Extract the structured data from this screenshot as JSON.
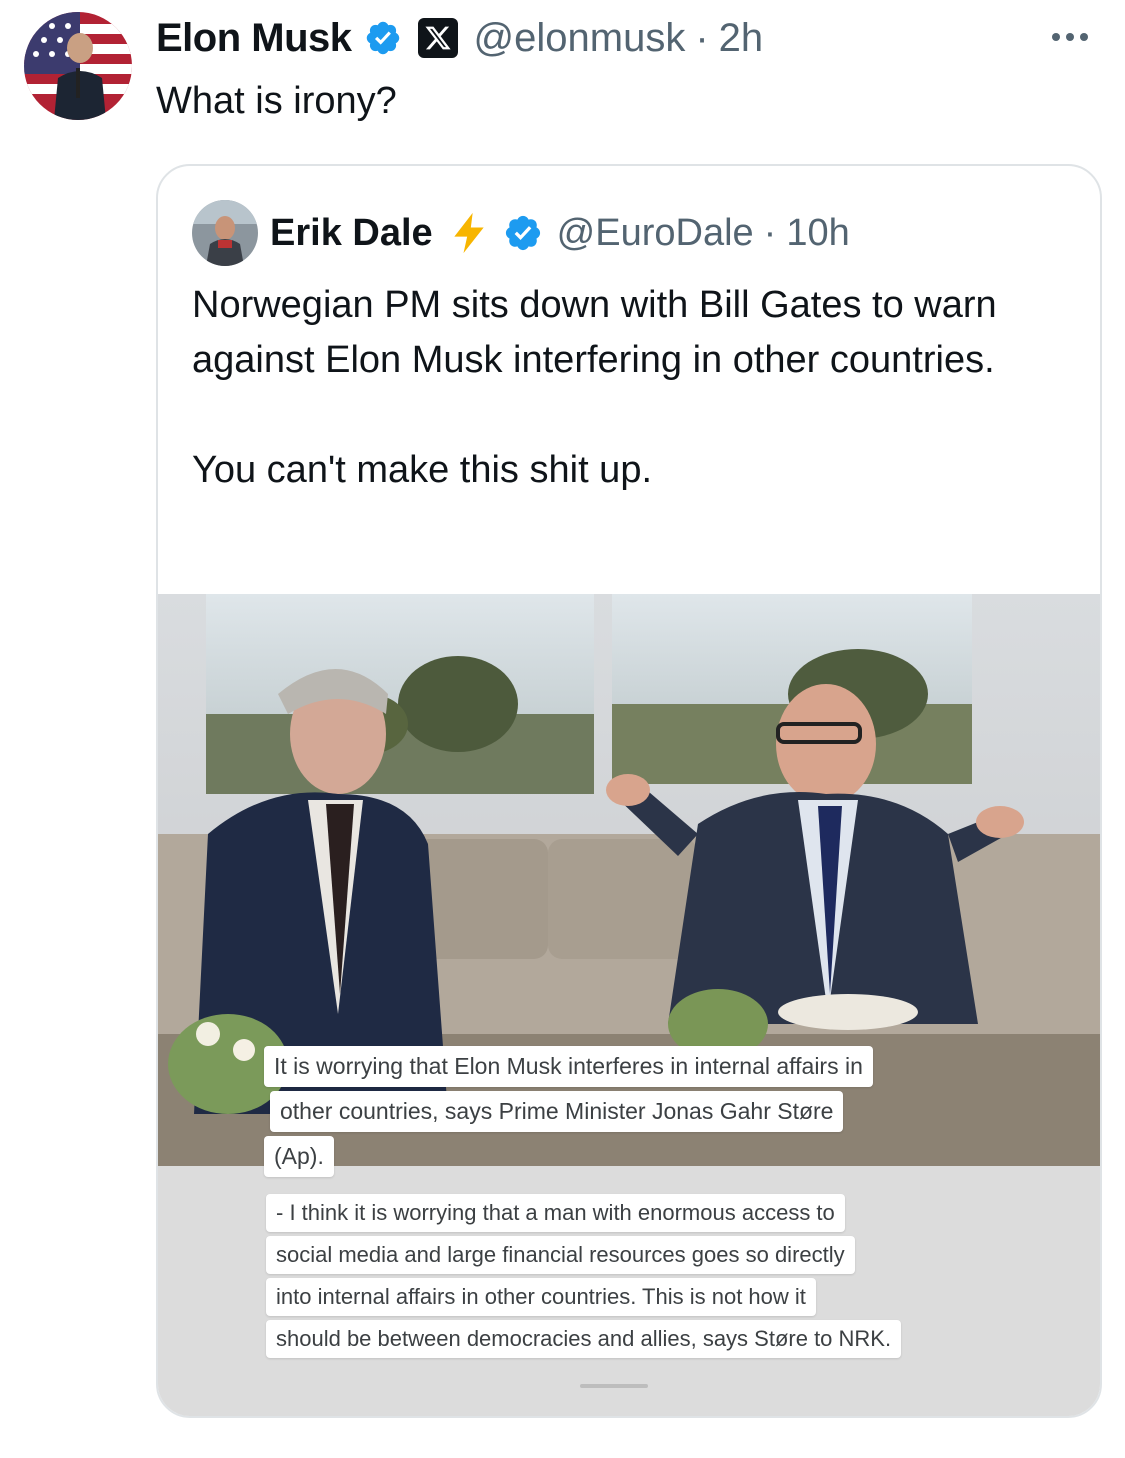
{
  "tweet": {
    "author_name": "Elon Musk",
    "handle": "@elonmusk",
    "separator": "·",
    "time": "2h",
    "text": "What is irony?",
    "avatar_icon": "elon-musk-avatar",
    "verified_icon": "verified-badge-icon",
    "affiliation_icon": "x-logo-icon",
    "more_icon": "more-options-icon"
  },
  "quoted_tweet": {
    "author_name": "Erik Dale",
    "handle": "@EuroDale",
    "separator": "·",
    "time": "10h",
    "paragraphs": [
      "Norwegian PM sits down with Bill Gates to warn against Elon Musk interfering in other countries.",
      "You can't make this shit up."
    ],
    "avatar_icon": "erik-dale-avatar",
    "bolt_icon": "lightning-bolt-icon",
    "verified_icon": "verified-badge-icon",
    "media": {
      "caption_1_lines": [
        "It is worrying that Elon Musk interferes in internal affairs in",
        "other countries, says Prime Minister Jonas Gahr Støre",
        "(Ap)."
      ],
      "caption_2_lines": [
        "- I think it is worrying that a man with enormous access to",
        "social media and large financial resources goes so directly",
        "into internal affairs in other countries. This is not how it",
        "should be between democracies and allies, says Støre to NRK."
      ]
    }
  },
  "colors": {
    "text": "#0f1419",
    "secondary": "#536471",
    "verified": "#1d9bf0",
    "bolt": "#f7b500",
    "border": "#dfe3e6"
  }
}
